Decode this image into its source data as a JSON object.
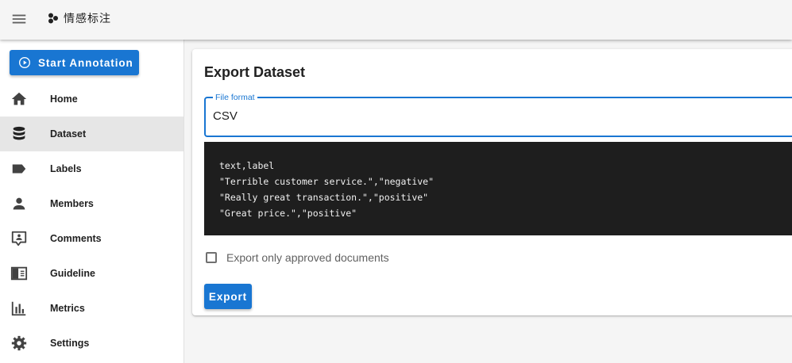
{
  "appbar": {
    "title": "情感标注",
    "menu_icon": "menu-icon",
    "brand_icon": "brand-icon"
  },
  "sidebar": {
    "start_button": {
      "label": "Start Annotation",
      "icon": "play-circle-icon"
    },
    "items": [
      {
        "label": "Home",
        "icon": "home-icon"
      },
      {
        "label": "Dataset",
        "icon": "database-icon",
        "active": true
      },
      {
        "label": "Labels",
        "icon": "label-icon"
      },
      {
        "label": "Members",
        "icon": "account-icon"
      },
      {
        "label": "Comments",
        "icon": "comment-account-icon"
      },
      {
        "label": "Guideline",
        "icon": "book-open-icon"
      },
      {
        "label": "Metrics",
        "icon": "chart-bar-icon"
      },
      {
        "label": "Settings",
        "icon": "gear-icon"
      }
    ]
  },
  "card": {
    "title": "Export Dataset",
    "file_format": {
      "label": "File format",
      "value": "CSV"
    },
    "preview": [
      "text,label",
      "\"Terrible customer service.\",\"negative\"",
      "\"Really great transaction.\",\"positive\"",
      "\"Great price.\",\"positive\""
    ],
    "checkbox": {
      "label": "Export only approved documents",
      "checked": false
    },
    "export_button": "Export"
  },
  "colors": {
    "primary": "#1976d2",
    "code_background": "#1e1e1e",
    "active_nav": "#e6e6e6",
    "icon": "#424242"
  }
}
